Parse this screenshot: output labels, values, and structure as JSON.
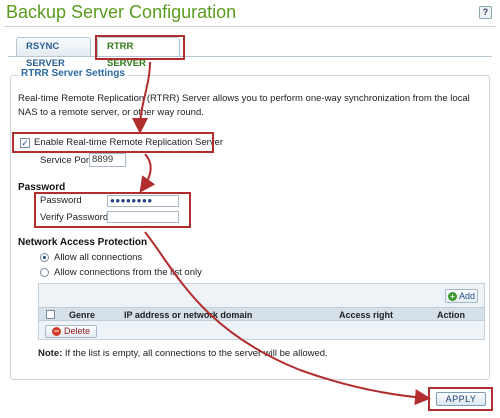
{
  "header": {
    "title": "Backup Server Configuration",
    "help_icon": "help-icon"
  },
  "tabs": [
    {
      "label": "RSYNC SERVER",
      "active": false
    },
    {
      "label": "RTRR SERVER",
      "active": true
    }
  ],
  "rtrr_settings": {
    "legend": "RTRR Server Settings",
    "description": "Real-time Remote Replication (RTRR) Server allows you to perform one-way synchronization from the local NAS to a remote server, or other way round.",
    "enable_label": "Enable Real-time Remote Replication Server",
    "enable_checked": true,
    "service_port_label": "Service Port",
    "service_port_value": "8899"
  },
  "password": {
    "heading": "Password",
    "password_label": "Password",
    "password_value": "●●●●●●●●",
    "verify_label": "Verify Password",
    "verify_value": ""
  },
  "network_access": {
    "heading": "Network Access Protection",
    "options": [
      {
        "label": "Allow all connections",
        "selected": true
      },
      {
        "label": "Allow connections from the list only",
        "selected": false
      }
    ],
    "add_label": "Add",
    "columns": [
      "Genre",
      "IP address or network domain",
      "Access right",
      "Action"
    ],
    "delete_label": "Delete"
  },
  "note": {
    "prefix": "Note:",
    "text": " If the list is empty, all connections to the server will be allowed."
  },
  "apply_label": "APPLY",
  "colors": {
    "title_green": "#5a9b1e",
    "highlight_red": "#b22d2d",
    "tab_blue": "#2a5f93"
  }
}
